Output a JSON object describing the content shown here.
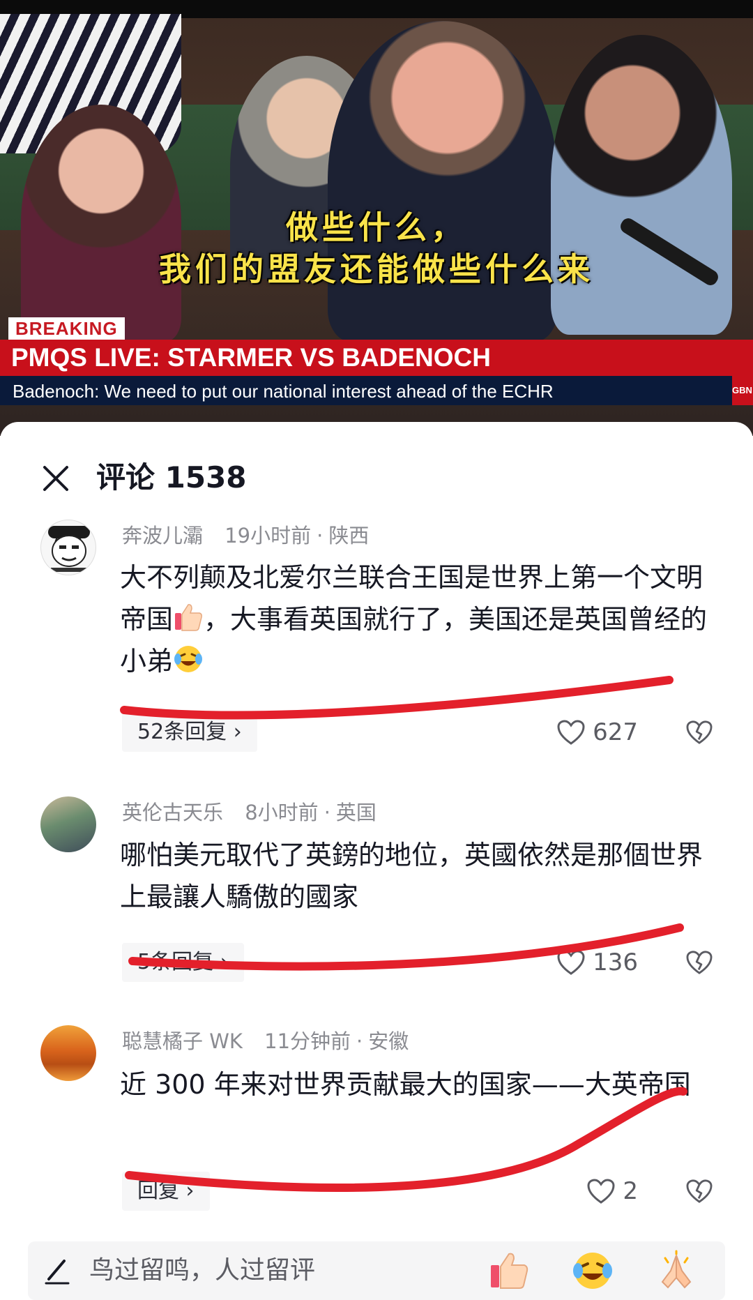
{
  "video": {
    "subtitle_line1": "做些什么，",
    "subtitle_line2": "我们的盟友还能做些什么来",
    "breaking": "BREAKING",
    "headline": "PMQS LIVE: STARMER VS BADENOCH",
    "ticker": "Badenoch: We need to put our national interest ahead of the ECHR",
    "channel": "GBN"
  },
  "comments_panel": {
    "title": "评论 1538",
    "input_placeholder": "鸟过留鸣，人过留评",
    "quick_emojis": [
      "thumbs-up-emoji",
      "laughing-crying-emoji",
      "praying-hands-emoji"
    ]
  },
  "comments": [
    {
      "user": "奔波儿灞",
      "time": "19小时前",
      "location": "陕西",
      "text_a": "大不列颠及北爱尔兰联合王国是世界上第一个文明帝国",
      "text_b": "，大事看英国就行了，美国还是英国曾经的小弟",
      "replies": "52条回复 ›",
      "likes": "627"
    },
    {
      "user": "英伦古天乐",
      "time": "8小时前",
      "location": "英国",
      "text": "哪怕美元取代了英鎊的地位，英國依然是那個世界上最讓人驕傲的國家",
      "replies": "5条回复 ›",
      "likes": "136"
    },
    {
      "user": "聪慧橘子 WK",
      "time": "11分钟前",
      "location": "安徽",
      "text": "近 300 年来对世界贡献最大的国家——大英帝国",
      "replies": "回复 ›",
      "likes": "2"
    }
  ],
  "annotation_color": "#e3202b"
}
